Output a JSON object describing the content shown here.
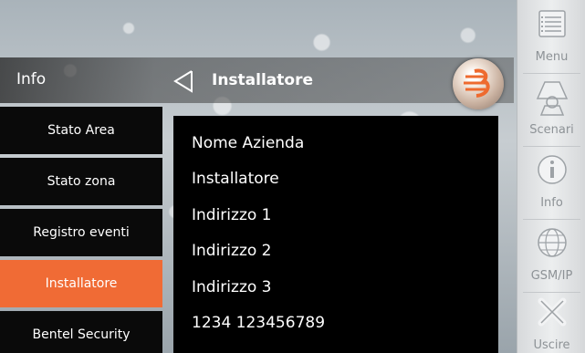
{
  "header": {
    "section_label": "Info",
    "title": "Installatore"
  },
  "left_menu": {
    "items": [
      {
        "label": "Stato Area"
      },
      {
        "label": "Stato zona"
      },
      {
        "label": "Registro eventi"
      },
      {
        "label": "Installatore",
        "active": true
      },
      {
        "label": "Bentel Security"
      }
    ]
  },
  "details": {
    "rows": [
      "Nome Azienda",
      "Installatore",
      "Indirizzo 1",
      "Indirizzo 2",
      "Indirizzo 3",
      "1234 123456789"
    ]
  },
  "sidebar": {
    "items": [
      {
        "label": "Menu",
        "icon": "menu-icon"
      },
      {
        "label": "Scenari",
        "icon": "scenari-icon"
      },
      {
        "label": "Info",
        "icon": "info-icon"
      },
      {
        "label": "GSM/IP",
        "icon": "globe-icon"
      },
      {
        "label": "Uscire",
        "icon": "exit-icon"
      }
    ]
  },
  "colors": {
    "accent": "#f06b35",
    "panel": "#000000",
    "sidebar_text": "#8d9296"
  }
}
